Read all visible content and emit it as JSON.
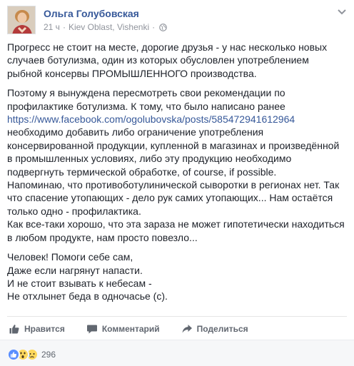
{
  "post": {
    "author": "Ольга Голубовская",
    "time": "21 ч",
    "location": "Kiev Oblast, Vishenki",
    "paragraphs": [
      [
        {
          "text": "Прогресс не стоит на месте, дорогие друзья - у нас несколько новых"
        },
        {
          "text": "случаев ботулизма, один из которых обусловлен употреблением"
        },
        {
          "text": "рыбной консервы ПРОМЫШЛЕННОГО производства."
        }
      ],
      [
        {
          "text": "Поэтому я вынуждена пересмотреть свои рекомендации по"
        },
        {
          "text": "профилактике ботулизма. К тому, что было написано ранее"
        },
        {
          "text": "https://www.facebook.com/ogolubovska/posts/585472941612964",
          "link": true
        },
        {
          "text": "необходимо добавить либо ограничение употребления"
        },
        {
          "text": "консервированной продукции, купленной в магазинах и произведённой"
        },
        {
          "text": "в промышленных условиях, либо эту продукцию необходимо"
        },
        {
          "text": "подвергнуть термической обработке, of course, if possible."
        },
        {
          "text": "Напоминаю, что противоботулинической сыворотки в регионах нет. Так"
        },
        {
          "text": "что спасение утопающих - дело рук самих утопающих... Нам остаётся"
        },
        {
          "text": "только одно - профилактика."
        },
        {
          "text": "Как все-таки хорошо, что эта зараза не может гипотетически находиться"
        },
        {
          "text": "в любом продукте, нам просто повезло..."
        }
      ],
      [
        {
          "text": "Человек! Помоги себе сам,"
        },
        {
          "text": "Даже если нагрянут напасти."
        },
        {
          "text": "И не стоит взывать к небесам -"
        },
        {
          "text": "Не отхлынет беда в одночасье (с)."
        }
      ]
    ]
  },
  "actions": {
    "like": "Нравится",
    "comment": "Комментарий",
    "share": "Поделиться"
  },
  "reactions": {
    "icons": [
      "like-icon",
      "wow-icon",
      "sad-icon"
    ],
    "count": "296"
  },
  "colors": {
    "link": "#365899",
    "text": "#1d2129",
    "meta": "#90949c",
    "like_blue": "#598eff",
    "reaction_yellow": "#fdd85d"
  }
}
